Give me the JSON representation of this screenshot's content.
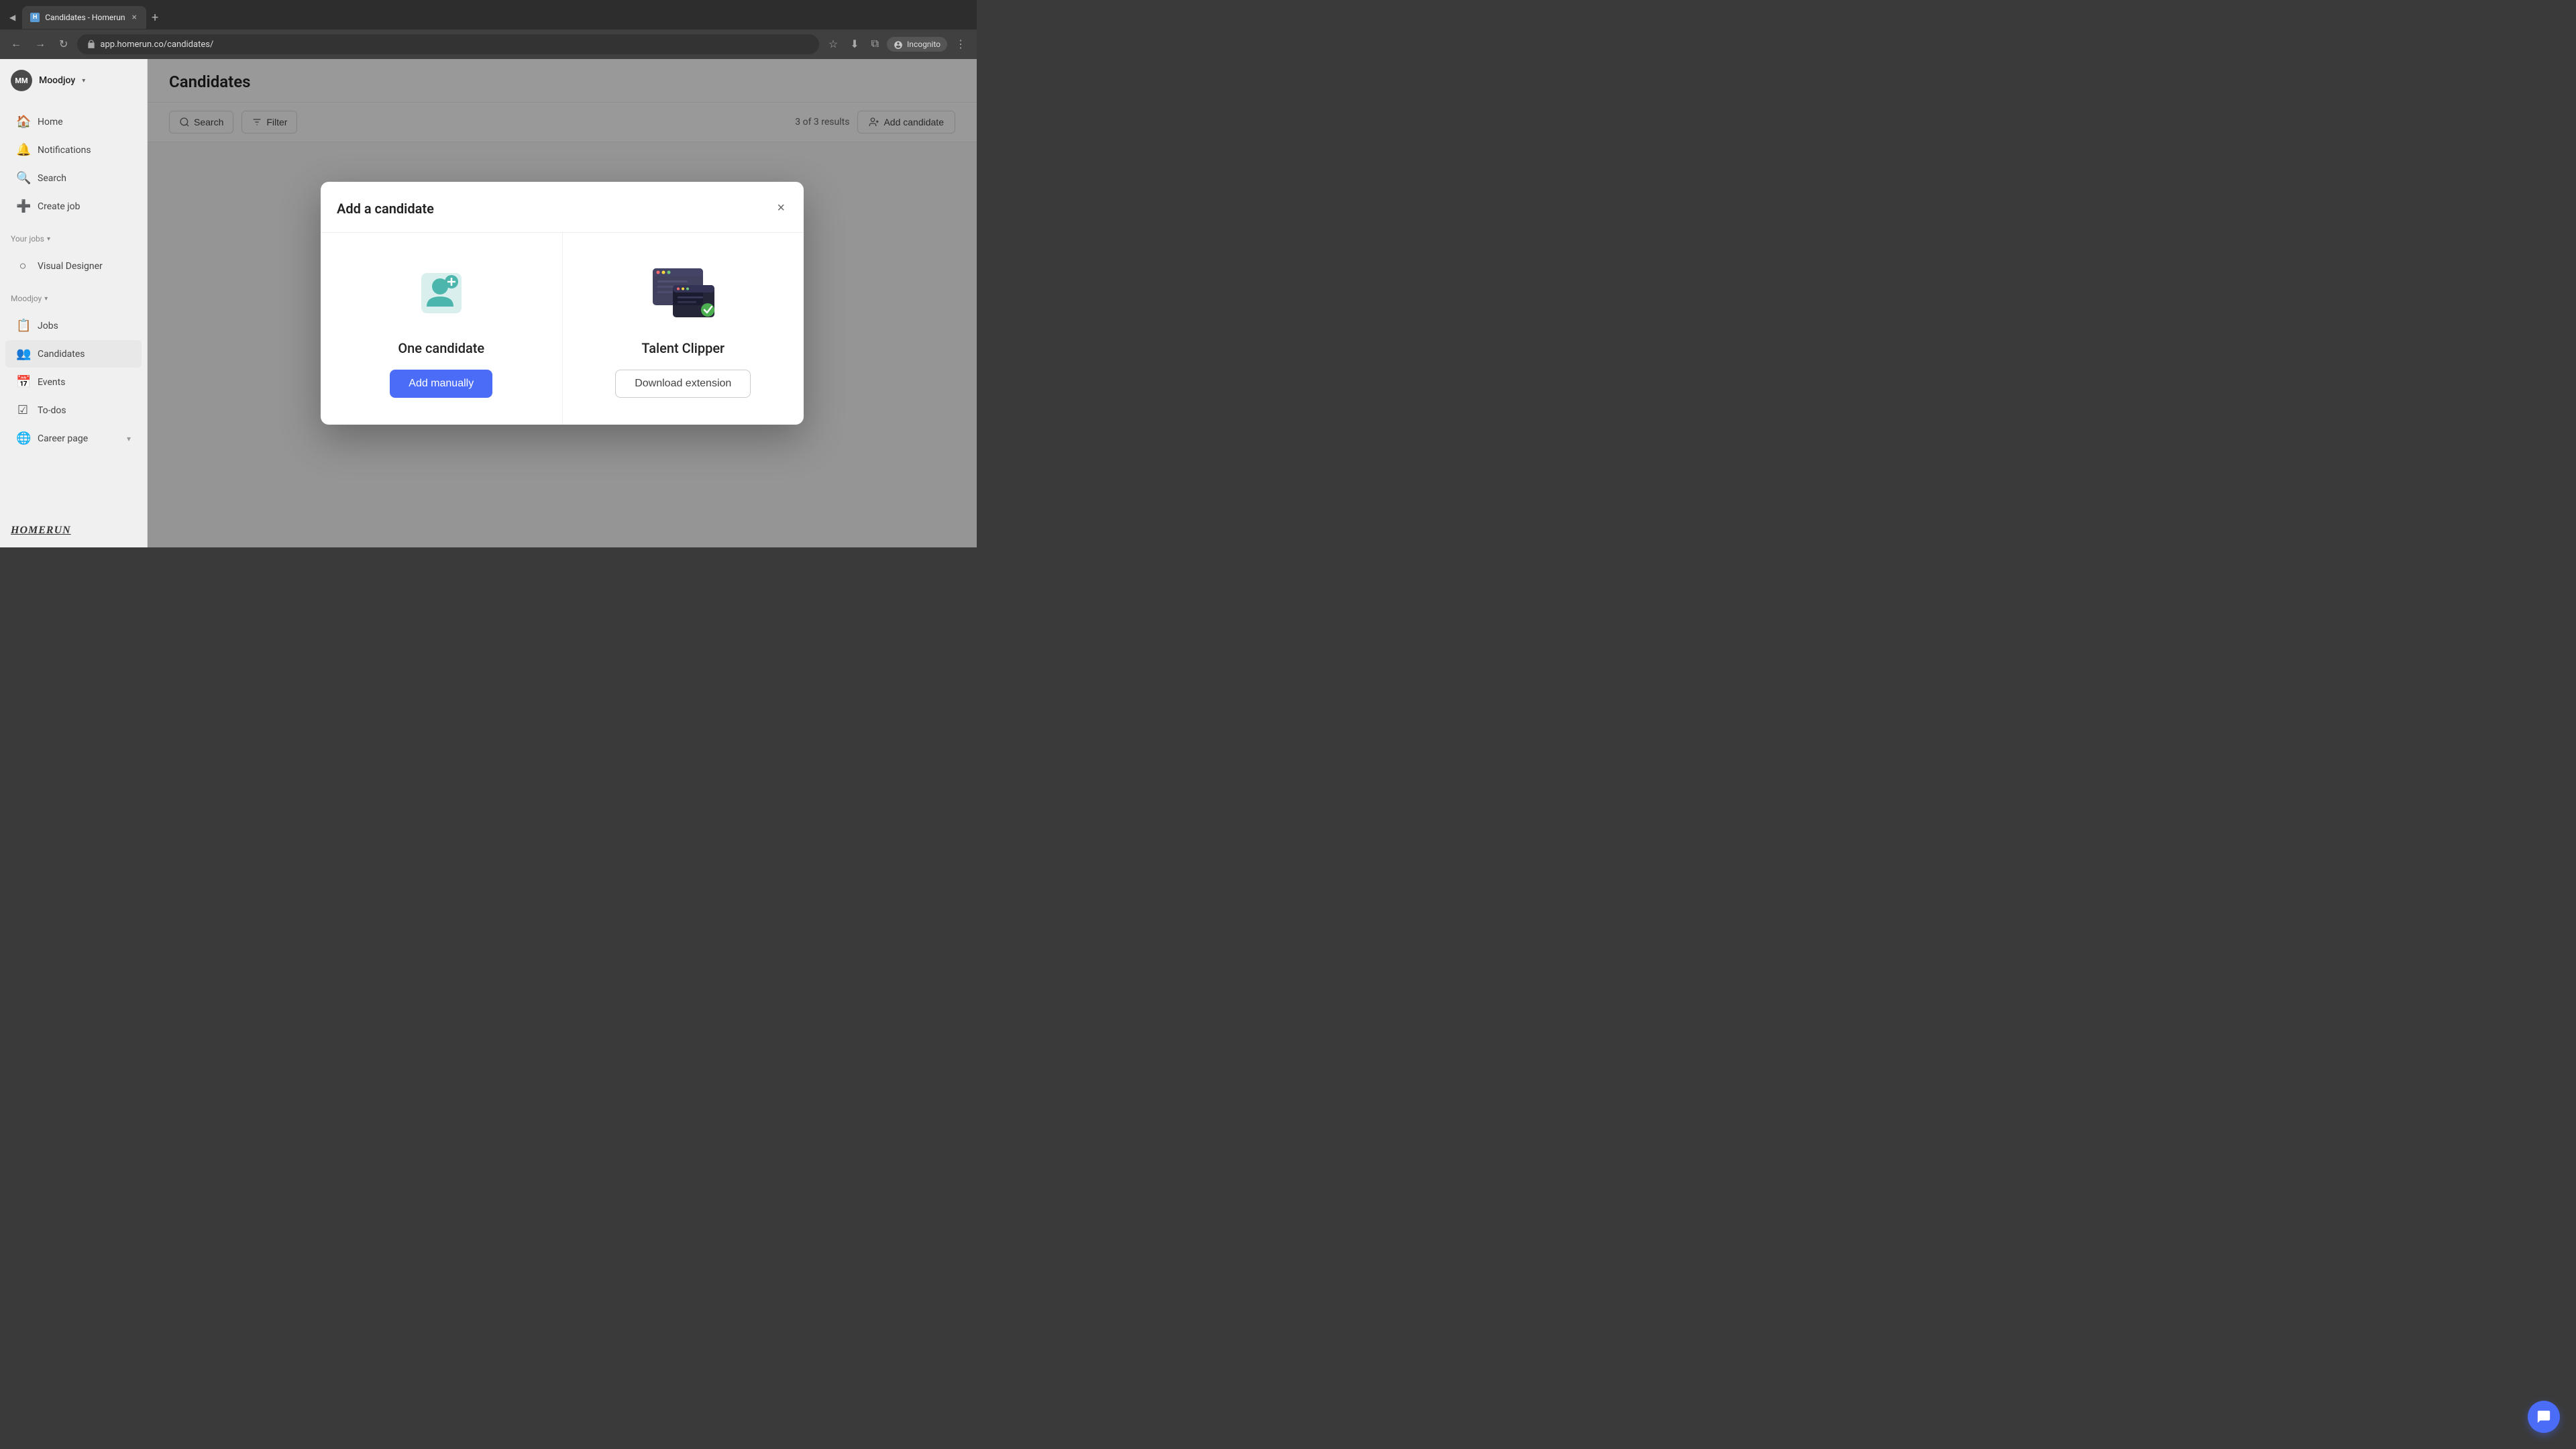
{
  "browser": {
    "tab": {
      "favicon": "H",
      "title": "Candidates - Homerun",
      "close": "×"
    },
    "new_tab": "+",
    "url": "app.homerun.co/candidates/",
    "incognito_label": "Incognito"
  },
  "sidebar": {
    "avatar_initials": "MM",
    "workspace_name": "Moodjoy",
    "workspace_chevron": "▾",
    "nav_items": [
      {
        "label": "Home",
        "icon": "🏠"
      },
      {
        "label": "Notifications",
        "icon": "🔔"
      },
      {
        "label": "Search",
        "icon": "🔍"
      },
      {
        "label": "Create job",
        "icon": "➕"
      }
    ],
    "your_jobs_label": "Your jobs",
    "your_jobs_chevron": "▾",
    "jobs": [
      {
        "label": "Visual Designer"
      }
    ],
    "moodjoy_label": "Moodjoy",
    "moodjoy_chevron": "▾",
    "moodjoy_items": [
      {
        "label": "Jobs",
        "icon": "📋"
      },
      {
        "label": "Candidates",
        "icon": "👥"
      },
      {
        "label": "Events",
        "icon": "📅"
      },
      {
        "label": "To-dos",
        "icon": "☑"
      },
      {
        "label": "Career page",
        "icon": "🌐"
      }
    ],
    "logo": "HOMERUN"
  },
  "main": {
    "page_title": "Candidates",
    "toolbar": {
      "search_label": "Search",
      "filter_label": "Filter",
      "results_text": "3 of 3 results",
      "add_candidate_label": "Add candidate"
    }
  },
  "modal": {
    "title": "Add a candidate",
    "close_label": "×",
    "options": [
      {
        "title": "One candidate",
        "button_label": "Add manually",
        "type": "primary"
      },
      {
        "title": "Talent Clipper",
        "button_label": "Download extension",
        "type": "secondary"
      }
    ]
  },
  "chat_icon": "💬"
}
